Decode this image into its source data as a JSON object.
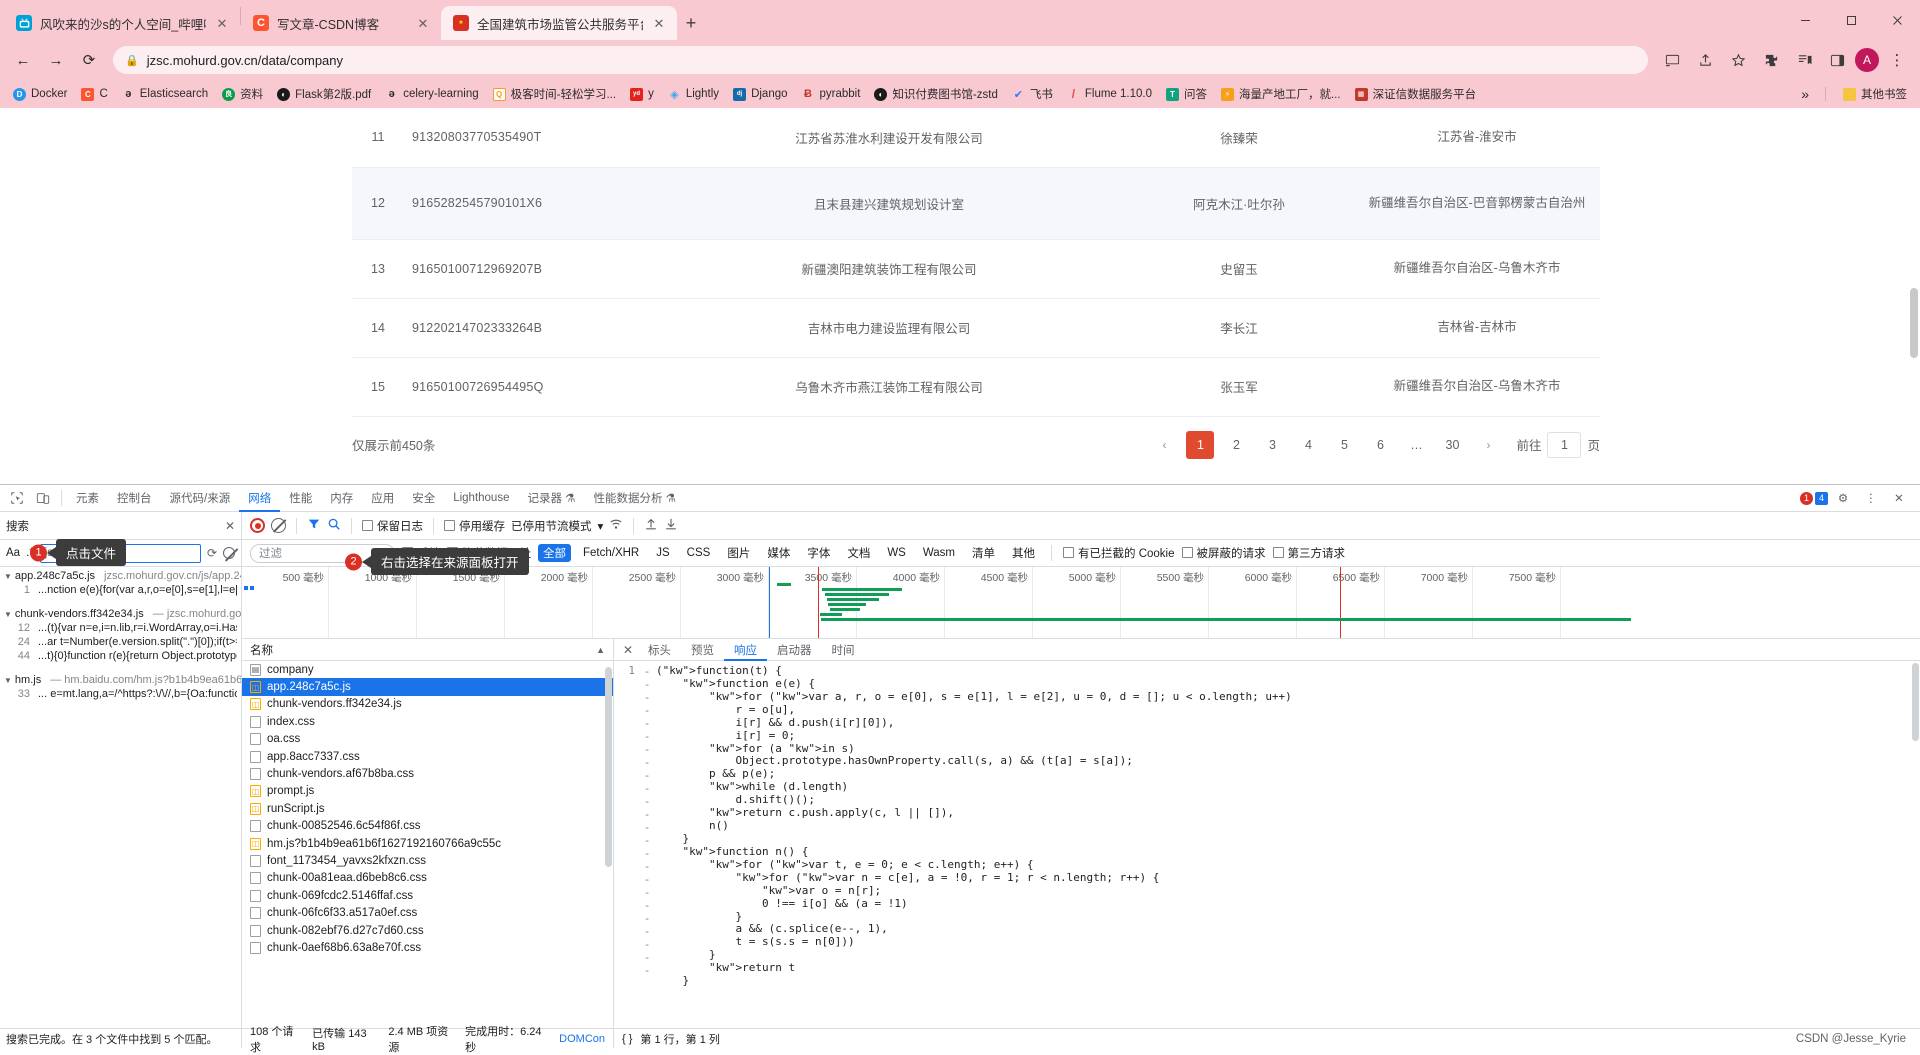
{
  "browser": {
    "tabs": [
      {
        "title": "风吹来的沙s的个人空间_哔哩哔",
        "favicon": "bilibili-icon",
        "color": "#00a1d6",
        "glyph": "📺",
        "active": false
      },
      {
        "title": "写文章-CSDN博客",
        "favicon": "csdn-icon",
        "color": "#fc5531",
        "glyph": "C",
        "active": false
      },
      {
        "title": "全国建筑市场监管公共服务平台",
        "favicon": "gov-icon",
        "color": "#d93025",
        "glyph": "🏛",
        "active": true
      }
    ],
    "newtab_label": "+",
    "nav": {
      "back": "←",
      "forward": "→",
      "reload": "⟳"
    },
    "address": {
      "lock_icon": "lock-icon",
      "url": "jzsc.mohurd.gov.cn/data/company"
    },
    "toolbar_icons": [
      "cast-icon",
      "share-icon",
      "star-icon",
      "extensions-icon",
      "reading-list-icon",
      "sidepanel-icon"
    ],
    "profile_initial": "A",
    "window_controls": [
      "minimize",
      "maximize",
      "close"
    ],
    "bookmarks": [
      {
        "label": "Docker",
        "glyph": "D",
        "color": "#2496ed"
      },
      {
        "label": "C",
        "glyph": "C",
        "color": "#fc5531"
      },
      {
        "label": "Elasticsearch",
        "glyph": "ə",
        "color": "#ffffff"
      },
      {
        "label": "资料",
        "glyph": "良",
        "color": "#0a9d4a"
      },
      {
        "label": "Flask第2版.pdf",
        "glyph": "◐",
        "color": "#1a1a1a"
      },
      {
        "label": "celery-learning",
        "glyph": "ə",
        "color": "#ffffff"
      },
      {
        "label": "极客时间-轻松学习...",
        "glyph": "Q",
        "color": "#f79c1e"
      },
      {
        "label": "y",
        "glyph": "yd",
        "color": "#e2231a"
      },
      {
        "label": "Lightly",
        "glyph": "◇",
        "color": "#3aa6f0"
      },
      {
        "label": "Django",
        "glyph": "dj",
        "color": "#1769aa"
      },
      {
        "label": "pyrabbit",
        "glyph": "Ⱅ",
        "color": "#c0392b"
      },
      {
        "label": "知识付费图书馆-zstd",
        "glyph": "◐",
        "color": "#1a1a1a"
      },
      {
        "label": "飞书",
        "glyph": "✈",
        "color": "#2c7ef8"
      },
      {
        "label": "Flume 1.10.0",
        "glyph": "/",
        "color": "#e54b4b"
      },
      {
        "label": "问答",
        "glyph": "T",
        "color": "#11a37f"
      },
      {
        "label": "海量产地工厂，就...",
        "glyph": "⚡",
        "color": "#f7a01b"
      },
      {
        "label": "深证信数据服务平台",
        "glyph": "▦",
        "color": "#c0392b"
      }
    ],
    "bookmarks_overflow": "»",
    "other_bookmarks": "其他书签"
  },
  "page": {
    "rows": [
      {
        "idx": "11",
        "code": "91320803770535490T",
        "name": "江苏省苏淮水利建设开发有限公司",
        "person": "徐臻荣",
        "region": "江苏省-淮安市"
      },
      {
        "idx": "12",
        "code": "9165282545790101X6",
        "name": "且末县建兴建筑规划设计室",
        "person": "阿克木江·吐尔孙",
        "region": "新疆维吾尔自治区-巴音郭楞蒙古自治州"
      },
      {
        "idx": "13",
        "code": "91650100712969207B",
        "name": "新疆澳阳建筑装饰工程有限公司",
        "person": "史留玉",
        "region": "新疆维吾尔自治区-乌鲁木齐市"
      },
      {
        "idx": "14",
        "code": "91220214702333264B",
        "name": "吉林市电力建设监理有限公司",
        "person": "李长江",
        "region": "吉林省-吉林市"
      },
      {
        "idx": "15",
        "code": "91650100726954495Q",
        "name": "乌鲁木齐市燕江装饰工程有限公司",
        "person": "张玉军",
        "region": "新疆维吾尔自治区-乌鲁木齐市"
      }
    ],
    "footer_note": "仅展示前450条",
    "pagination": {
      "prev": "‹",
      "pages": [
        "1",
        "2",
        "3",
        "4",
        "5",
        "6",
        "…",
        "30"
      ],
      "active": "1",
      "next": "›",
      "jump_prefix": "前往",
      "jump_value": "1",
      "jump_suffix": "页"
    }
  },
  "devtools": {
    "panel_tabs": [
      {
        "label": "元素",
        "selected": false
      },
      {
        "label": "控制台",
        "selected": false
      },
      {
        "label": "源代码/来源",
        "selected": false
      },
      {
        "label": "网络",
        "selected": true
      },
      {
        "label": "性能",
        "selected": false
      },
      {
        "label": "内存",
        "selected": false
      },
      {
        "label": "应用",
        "selected": false
      },
      {
        "label": "安全",
        "selected": false
      },
      {
        "label": "Lighthouse",
        "selected": false
      },
      {
        "label": "记录器 ⚗",
        "selected": false
      },
      {
        "label": "性能数据分析 ⚗",
        "selected": false
      }
    ],
    "error_count": "1",
    "warn_count": "4",
    "search_panel": {
      "title": "搜索",
      "close": "✕",
      "match_case_icon": "Aa",
      "regex_icon": ".*",
      "query": "json.parse",
      "refresh_icon": "refresh-icon",
      "clear_icon": "clear-icon",
      "status": "搜索已完成。在 3 个文件中找到 5 个匹配。",
      "results": [
        {
          "file": "app.248c7a5c.js",
          "url": "jzsc.mohurd.gov.cn/js/app.248c...",
          "lines": [
            {
              "n": "1",
              "text": "...nction e(e){for(var a,r,o=e[0],s=e[1],l=e[2],u=0,..."
            }
          ]
        },
        {
          "file": "chunk-vendors.ff342e34.js",
          "url": "jzsc.mohurd.gov.cn/j...",
          "lines": [
            {
              "n": "12",
              "text": "...(t){var n=e,i=n.lib,r=i.WordArray,o=i.Hasher,s..."
            },
            {
              "n": "24",
              "text": "...ar t=Number(e.version.split(\".\")[0]);if(t>=2)e...."
            },
            {
              "n": "44",
              "text": "...t){0}function r(e){return Object.prototype.toSt..."
            }
          ]
        },
        {
          "file": "hm.js",
          "url": "hm.baidu.com/hm.js?b1b4b9ea61b6f1627...",
          "lines": [
            {
              "n": "33",
              "text": "... e=mt.lang,a=/^https?:\\/\\//,b={Oa:function(a..."
            }
          ]
        }
      ]
    },
    "network_controls": {
      "record_icon": "record-icon",
      "clear_icon": "clear-icon",
      "filter_icon": "filter-icon",
      "search_icon": "search-icon",
      "preserve_log": "保留日志",
      "disable_cache": "停用缓存",
      "throttling": "已停用节流模式",
      "throttle_caret": "▾",
      "wifi_icon": "wifi-icon",
      "import_icon": "import-icon",
      "export_icon": "export-icon"
    },
    "filter_row": {
      "filter_placeholder": "过滤",
      "invert": "反转",
      "hide_data_urls": "隐藏数据网址",
      "types": [
        "全部",
        "Fetch/XHR",
        "JS",
        "CSS",
        "图片",
        "媒体",
        "字体",
        "文档",
        "WS",
        "Wasm",
        "清单",
        "其他"
      ],
      "active_type": "全部",
      "blocked_cookies": "有已拦截的 Cookie",
      "blocked_requests": "被屏蔽的请求",
      "third_party": "第三方请求"
    },
    "overview_ticks": [
      "500 毫秒",
      "1000 毫秒",
      "1500 毫秒",
      "2000 毫秒",
      "2500 毫秒",
      "3000 毫秒",
      "3500 毫秒",
      "4000 毫秒",
      "4500 毫秒",
      "5000 毫秒",
      "5500 毫秒",
      "6000 毫秒",
      "6500 毫秒",
      "7000 毫秒",
      "7500 毫秒"
    ],
    "requests": {
      "header": "名称",
      "items": [
        {
          "name": "company",
          "type": "doc",
          "selected": false
        },
        {
          "name": "app.248c7a5c.js",
          "type": "js",
          "selected": true
        },
        {
          "name": "chunk-vendors.ff342e34.js",
          "type": "js",
          "selected": false
        },
        {
          "name": "index.css",
          "type": "css",
          "selected": false
        },
        {
          "name": "oa.css",
          "type": "css",
          "selected": false
        },
        {
          "name": "app.8acc7337.css",
          "type": "css",
          "selected": false
        },
        {
          "name": "chunk-vendors.af67b8ba.css",
          "type": "css",
          "selected": false
        },
        {
          "name": "prompt.js",
          "type": "js",
          "selected": false
        },
        {
          "name": "runScript.js",
          "type": "js",
          "selected": false
        },
        {
          "name": "chunk-00852546.6c54f86f.css",
          "type": "css",
          "selected": false
        },
        {
          "name": "hm.js?b1b4b9ea61b6f1627192160766a9c55c",
          "type": "js",
          "selected": false
        },
        {
          "name": "font_1173454_yavxs2kfxzn.css",
          "type": "css",
          "selected": false
        },
        {
          "name": "chunk-00a81eaa.d6beb8c6.css",
          "type": "css",
          "selected": false
        },
        {
          "name": "chunk-069fcdc2.5146ffaf.css",
          "type": "css",
          "selected": false
        },
        {
          "name": "chunk-06fc6f33.a517a0ef.css",
          "type": "css",
          "selected": false
        },
        {
          "name": "chunk-082ebf76.d27c7d60.css",
          "type": "css",
          "selected": false
        },
        {
          "name": "chunk-0aef68b6.63a8e70f.css",
          "type": "css",
          "selected": false
        }
      ]
    },
    "response_tabs": [
      {
        "label": "标头",
        "selected": false
      },
      {
        "label": "预览",
        "selected": false
      },
      {
        "label": "响应",
        "selected": true
      },
      {
        "label": "启动器",
        "selected": false
      },
      {
        "label": "时间",
        "selected": false
      }
    ],
    "response_close": "✕",
    "code_lines": [
      {
        "n": "1",
        "fold": "",
        "text": "(function(t) {"
      },
      {
        "n": "",
        "fold": "-",
        "text": "    function e(e) {"
      },
      {
        "n": "",
        "fold": "-",
        "text": "        for (var a, r, o = e[0], s = e[1], l = e[2], u = 0, d = []; u < o.length; u++)"
      },
      {
        "n": "",
        "fold": "-",
        "text": "            r = o[u],"
      },
      {
        "n": "",
        "fold": "-",
        "text": "            i[r] && d.push(i[r][0]),"
      },
      {
        "n": "",
        "fold": "-",
        "text": "            i[r] = 0;"
      },
      {
        "n": "",
        "fold": "-",
        "text": "        for (a in s)"
      },
      {
        "n": "",
        "fold": "-",
        "text": "            Object.prototype.hasOwnProperty.call(s, a) && (t[a] = s[a]);"
      },
      {
        "n": "",
        "fold": "-",
        "text": "        p && p(e);"
      },
      {
        "n": "",
        "fold": "-",
        "text": "        while (d.length)"
      },
      {
        "n": "",
        "fold": "-",
        "text": "            d.shift()();"
      },
      {
        "n": "",
        "fold": "-",
        "text": "        return c.push.apply(c, l || []),"
      },
      {
        "n": "",
        "fold": "-",
        "text": "        n()"
      },
      {
        "n": "",
        "fold": "-",
        "text": "    }"
      },
      {
        "n": "",
        "fold": "-",
        "text": "    function n() {"
      },
      {
        "n": "",
        "fold": "-",
        "text": "        for (var t, e = 0; e < c.length; e++) {"
      },
      {
        "n": "",
        "fold": "-",
        "text": "            for (var n = c[e], a = !0, r = 1; r < n.length; r++) {"
      },
      {
        "n": "",
        "fold": "-",
        "text": "                var o = n[r];"
      },
      {
        "n": "",
        "fold": "-",
        "text": "                0 !== i[o] && (a = !1)"
      },
      {
        "n": "",
        "fold": "-",
        "text": "            }"
      },
      {
        "n": "",
        "fold": "-",
        "text": "            a && (c.splice(e--, 1),"
      },
      {
        "n": "",
        "fold": "-",
        "text": "            t = s(s.s = n[0]))"
      },
      {
        "n": "",
        "fold": "-",
        "text": "        }"
      },
      {
        "n": "",
        "fold": "-",
        "text": "        return t"
      },
      {
        "n": "",
        "fold": "-",
        "text": "    }"
      }
    ],
    "status_bar": {
      "requests": "108 个请求",
      "transferred": "已传输 143 kB",
      "resources": "2.4 MB 项资源",
      "finish": "完成用时：6.24 秒",
      "domcontent": "DOMCon",
      "cursor": "第 1 行，第 1 列",
      "format_icon": "format-icon"
    },
    "watermark": "CSDN @Jesse_Kyrie"
  },
  "callouts": [
    {
      "step": "1",
      "text": "点击文件"
    },
    {
      "step": "2",
      "text": "右击选择在来源面板打开"
    }
  ]
}
